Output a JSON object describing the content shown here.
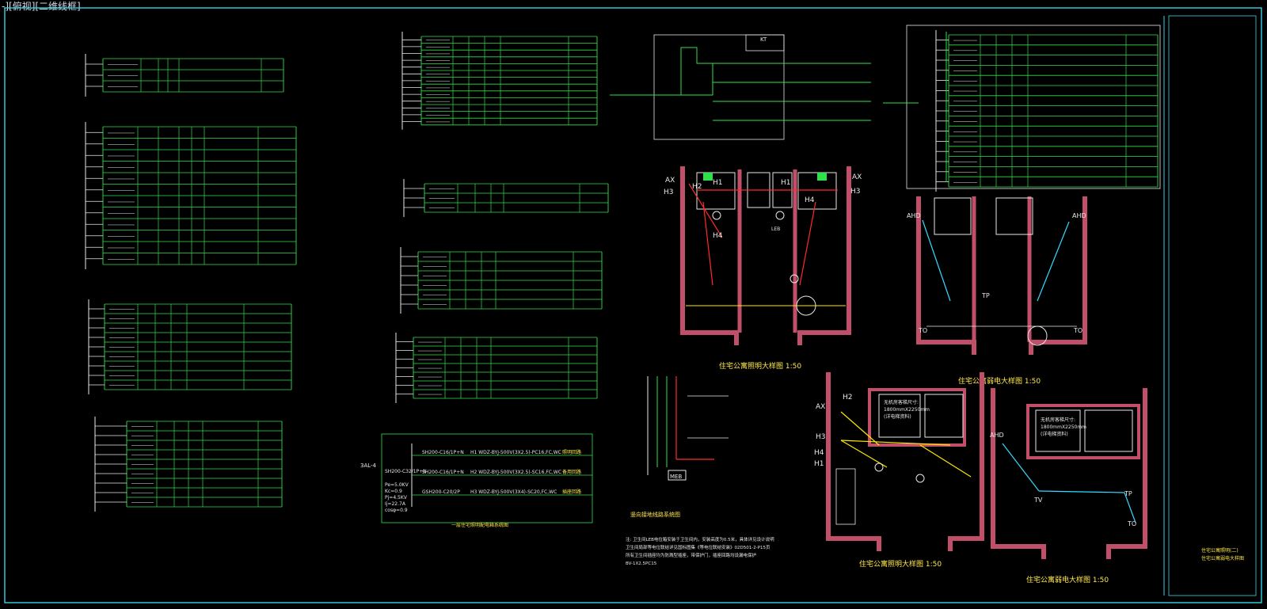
{
  "viewport": {
    "label": "-][俯视][二维线框]"
  },
  "top_labels": {
    "ax": "AX",
    "ahd": "AHD",
    "h1": "H1",
    "h2": "H2",
    "h3": "H3",
    "h4": "H4",
    "tp": "TP",
    "to": "TO",
    "tv": "TV",
    "kt": "KT",
    "meb": "MEB",
    "leb": "LEB"
  },
  "panel_texts": {
    "al4_name": "3AL-4",
    "al4_pe": "Pe=5.0KV",
    "al4_kc": "Kc=0.9",
    "al4_pj": "Pj=4.5KV",
    "al4_ij": "Ij=22.7A",
    "al4_cos": "cosφ=0.9",
    "al4_b1": "SH200-C32/1P+N",
    "al4_b2": "SH200-C16/1P+N",
    "al4_b3": "SH200-C16/1P+N",
    "al4_b4": "GSH200-C20/2P",
    "al4_c1": "H1  WDZ-BYJ-500V(3X2.5)-PC16,FC,WC",
    "al4_c2": "H2  WDZ-BYJ-500V(3X2.5)-SC16,FC,WC",
    "al4_c3": "H3  WDZ-BYJ-500V(3X4)-SC20,FC,WC",
    "al4_n1": "照明回路",
    "al4_n2": "备用回路",
    "al4_n3": "插座回路",
    "al4_title": "一层住宅照明配电箱系统图"
  },
  "titles": {
    "lighting_1": "住宅公寓照明大样图 1:50",
    "power_1": "住宅公寓弱电大样图 1:50",
    "lighting_2": "住宅公寓照明大样图 1:50",
    "power_2": "住宅公寓弱电大样图 1:50",
    "grounding": "竖向接地线路系统图"
  },
  "room_notes": {
    "aircon_box_1_line1": "无机房客梯尺寸:",
    "aircon_box_1_line2": "1800mmX2250mm",
    "aircon_box_1_line3": "(详电梯资料)",
    "aircon_box_2_line1": "无机房客梯尺寸:",
    "aircon_box_2_line2": "1800mmX2250mm",
    "aircon_box_2_line3": "(详电梯资料)"
  },
  "notes": {
    "line1": "注: 卫生间LEB电位箱安装于卫生间内，安装高度为0.5米，具体详见设计说明",
    "line2": "卫生间局部等电位联结详见国标图集《等电位联结安装》02D501-2-P15页",
    "line3": "所有卫生间插座均为防溅型插座，带保护门，插座回路均设漏电保护",
    "line4": "BV-1X2.5PC15"
  },
  "title_block": {
    "line1": "住宅公寓照明(二)",
    "line2": "住宅公寓弱电大样图"
  },
  "colors": {
    "background": "#000000",
    "frame": "#3ad2e6",
    "green": "#2fe04a",
    "white": "#e8e8e8",
    "yellow": "#ffe600",
    "red": "#ff2a2a",
    "wall": "#c24f6a",
    "cyan": "#36d9ff",
    "title": "#ffe94a"
  }
}
